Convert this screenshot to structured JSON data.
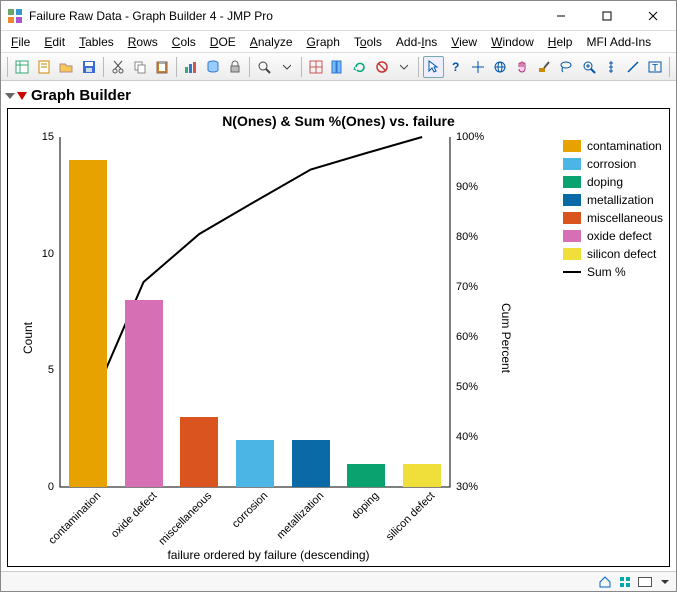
{
  "window": {
    "title": "Failure Raw Data - Graph Builder 4 - JMP Pro"
  },
  "menus": {
    "file": "File",
    "edit": "Edit",
    "tables": "Tables",
    "rows": "Rows",
    "cols": "Cols",
    "doe": "DOE",
    "analyze": "Analyze",
    "graph": "Graph",
    "tools": "Tools",
    "addins": "Add-Ins",
    "view": "View",
    "window": "Window",
    "help": "Help",
    "mfi": "MFI Add-Ins"
  },
  "panel": {
    "title": "Graph Builder"
  },
  "chart_data": {
    "type": "bar",
    "title": "N(Ones) & Sum %(Ones) vs. failure",
    "xlabel": "failure ordered by failure (descending)",
    "ylabel": "Count",
    "y2label": "Cum Percent",
    "ylim": [
      0,
      15
    ],
    "y2lim": [
      30,
      100
    ],
    "yticks": [
      0,
      5,
      10,
      15
    ],
    "y2ticks": [
      30,
      40,
      50,
      60,
      70,
      80,
      90,
      100
    ],
    "categories": [
      "contamination",
      "oxide defect",
      "miscellaneous",
      "corrosion",
      "metallization",
      "doping",
      "silicon defect"
    ],
    "values": [
      14,
      8,
      3,
      2,
      2,
      1,
      1
    ],
    "colors": [
      "#e8a200",
      "#d66fb3",
      "#d9541e",
      "#4bb6e6",
      "#0a6aa8",
      "#0aa36f",
      "#f0df3a"
    ],
    "series_line": {
      "name": "Sum %",
      "values": [
        45.2,
        71.0,
        80.6,
        87.1,
        93.5,
        96.8,
        100.0
      ],
      "color": "#000000"
    },
    "legend": [
      {
        "label": "contamination",
        "color": "#e8a200"
      },
      {
        "label": "corrosion",
        "color": "#4bb6e6"
      },
      {
        "label": "doping",
        "color": "#0aa36f"
      },
      {
        "label": "metallization",
        "color": "#0a6aa8"
      },
      {
        "label": "miscellaneous",
        "color": "#d9541e"
      },
      {
        "label": "oxide defect",
        "color": "#d66fb3"
      },
      {
        "label": "silicon defect",
        "color": "#f0df3a"
      }
    ]
  }
}
